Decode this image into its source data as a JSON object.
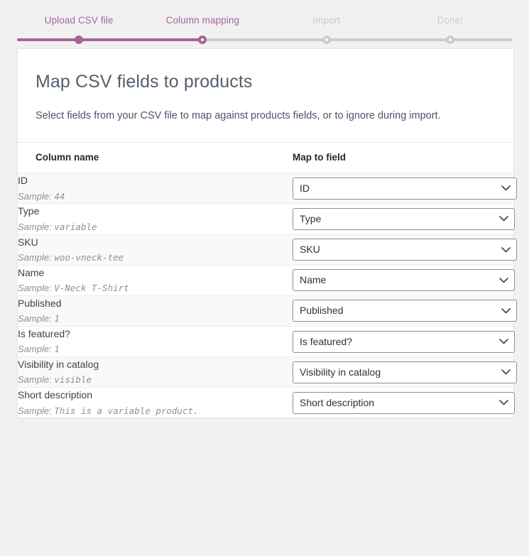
{
  "colors": {
    "accent": "#a46497",
    "inactive": "#cccccc",
    "page_background": "#f1f1f1",
    "card_background": "#ffffff",
    "row_shaded": "#f9f9f9",
    "heading": "#52606d",
    "select_border": "#8c8f94"
  },
  "stepper": {
    "steps": [
      {
        "label": "Upload CSV file",
        "state": "done"
      },
      {
        "label": "Column mapping",
        "state": "active"
      },
      {
        "label": "Import",
        "state": "todo"
      },
      {
        "label": "Done!",
        "state": "todo"
      }
    ]
  },
  "card": {
    "title": "Map CSV fields to products",
    "description": "Select fields from your CSV file to map against products fields, or to ignore during import."
  },
  "table": {
    "headers": {
      "column_name": "Column name",
      "map_to_field": "Map to field"
    },
    "sample_prefix": "Sample:",
    "rows": [
      {
        "name": "ID",
        "sample": "44",
        "mapped": "ID",
        "shaded": true
      },
      {
        "name": "Type",
        "sample": "variable",
        "mapped": "Type",
        "shaded": false
      },
      {
        "name": "SKU",
        "sample": "woo-vneck-tee",
        "mapped": "SKU",
        "shaded": true
      },
      {
        "name": "Name",
        "sample": "V-Neck T-Shirt",
        "mapped": "Name",
        "shaded": false
      },
      {
        "name": "Published",
        "sample": "1",
        "mapped": "Published",
        "shaded": true
      },
      {
        "name": "Is featured?",
        "sample": "1",
        "mapped": "Is featured?",
        "shaded": false
      },
      {
        "name": "Visibility in catalog",
        "sample": "visible",
        "mapped": "Visibility in catalog",
        "shaded": true
      },
      {
        "name": "Short description",
        "sample": "This is a variable product.",
        "mapped": "Short description",
        "shaded": false
      }
    ]
  }
}
